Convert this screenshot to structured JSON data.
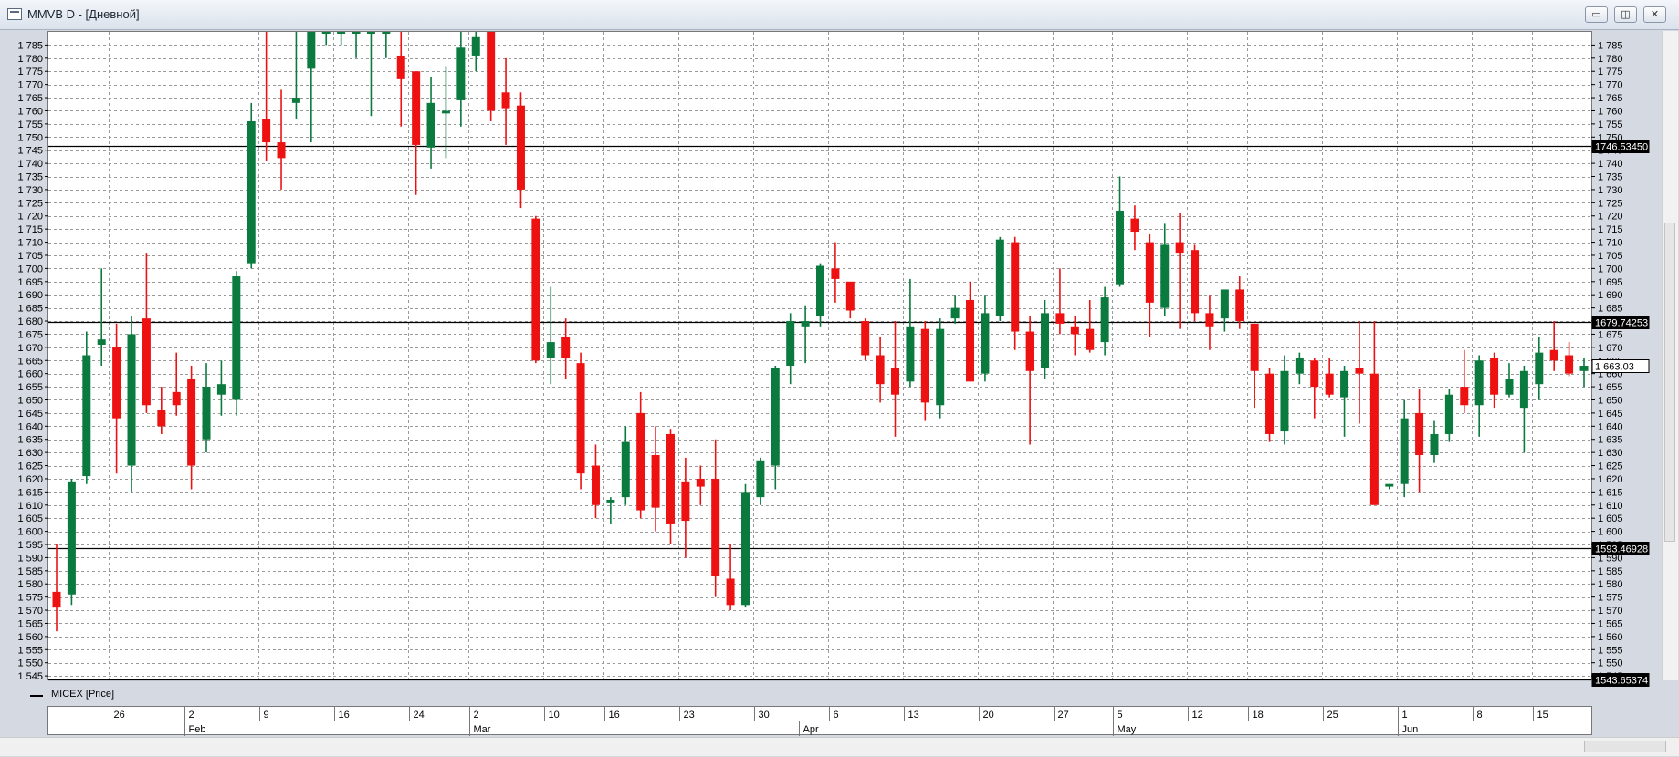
{
  "window": {
    "title": "MMVB D - [Дневной]",
    "buttons": {
      "minimize": "▭",
      "restore": "◫",
      "close": "✕"
    }
  },
  "legend": {
    "label": "MICEX [Price]"
  },
  "colors": {
    "up": "#0a7a3e",
    "down": "#ee1111",
    "grid": "#9a9a9a",
    "hline": "#000000",
    "marker_bg": "#000000",
    "marker_fg": "#ffffff"
  },
  "chart_data": {
    "type": "candlestick",
    "title": "",
    "ylim": [
      1543.65,
      1790
    ],
    "y_ticks": [
      1545,
      1550,
      1555,
      1560,
      1565,
      1570,
      1575,
      1580,
      1585,
      1590,
      1595,
      1600,
      1605,
      1610,
      1615,
      1620,
      1625,
      1630,
      1635,
      1640,
      1645,
      1650,
      1655,
      1660,
      1665,
      1670,
      1675,
      1680,
      1685,
      1690,
      1695,
      1700,
      1705,
      1710,
      1715,
      1720,
      1725,
      1730,
      1735,
      1740,
      1745,
      1750,
      1755,
      1760,
      1765,
      1770,
      1775,
      1780,
      1785
    ],
    "y_tick_labels": [
      "1 545",
      "1 550",
      "1 555",
      "1 560",
      "1 565",
      "1 570",
      "1 575",
      "1 580",
      "1 585",
      "1 590",
      "1 595",
      "1 600",
      "1 605",
      "1 610",
      "1 615",
      "1 620",
      "1 625",
      "1 630",
      "1 635",
      "1 640",
      "1 645",
      "1 650",
      "1 655",
      "1 660",
      "1 665",
      "1 670",
      "1 675",
      "1 680",
      "1 685",
      "1 690",
      "1 695",
      "1 700",
      "1 705",
      "1 710",
      "1 715",
      "1 720",
      "1 725",
      "1 730",
      "1 735",
      "1 740",
      "1 745",
      "1 750",
      "1 755",
      "1 760",
      "1 765",
      "1 770",
      "1 775",
      "1 780",
      "1 785"
    ],
    "horizontal_lines": [
      {
        "value": 1746.5345,
        "label": "1746.53450",
        "style": "black"
      },
      {
        "value": 1679.74253,
        "label": "1679.74253",
        "style": "black"
      },
      {
        "value": 1663.03,
        "label": "1 663.03",
        "style": "boxed"
      },
      {
        "value": 1593.46928,
        "label": "1593.46928",
        "style": "black"
      },
      {
        "value": 1543.65374,
        "label": "1543.65374",
        "style": "black"
      }
    ],
    "day_labels": [
      {
        "index": 4,
        "text": "26"
      },
      {
        "index": 9,
        "text": "2"
      },
      {
        "index": 14,
        "text": "9"
      },
      {
        "index": 19,
        "text": "16"
      },
      {
        "index": 24,
        "text": "24"
      },
      {
        "index": 28,
        "text": "2"
      },
      {
        "index": 33,
        "text": "10"
      },
      {
        "index": 37,
        "text": "16"
      },
      {
        "index": 42,
        "text": "23"
      },
      {
        "index": 47,
        "text": "30"
      },
      {
        "index": 52,
        "text": "6"
      },
      {
        "index": 57,
        "text": "13"
      },
      {
        "index": 62,
        "text": "20"
      },
      {
        "index": 67,
        "text": "27"
      },
      {
        "index": 71,
        "text": "5"
      },
      {
        "index": 76,
        "text": "12"
      },
      {
        "index": 80,
        "text": "18"
      },
      {
        "index": 85,
        "text": "25"
      },
      {
        "index": 90,
        "text": "1"
      },
      {
        "index": 95,
        "text": "8"
      },
      {
        "index": 99,
        "text": "15"
      }
    ],
    "month_labels": [
      {
        "index": 9,
        "text": "Feb"
      },
      {
        "index": 28,
        "text": "Mar"
      },
      {
        "index": 50,
        "text": "Apr"
      },
      {
        "index": 71,
        "text": "May"
      },
      {
        "index": 90,
        "text": "Jun"
      }
    ],
    "candles": [
      [
        1577,
        1595,
        1562,
        1571
      ],
      [
        1576,
        1620,
        1572,
        1619
      ],
      [
        1621,
        1676,
        1618,
        1667
      ],
      [
        1671,
        1700,
        1663,
        1673
      ],
      [
        1670,
        1679,
        1622,
        1643
      ],
      [
        1625,
        1682,
        1615,
        1675
      ],
      [
        1681,
        1706,
        1645,
        1648
      ],
      [
        1646,
        1655,
        1637,
        1640
      ],
      [
        1653,
        1668,
        1644,
        1648
      ],
      [
        1658,
        1663,
        1616,
        1625
      ],
      [
        1635,
        1664,
        1630,
        1655
      ],
      [
        1652,
        1665,
        1644,
        1656
      ],
      [
        1650,
        1699,
        1644,
        1697
      ],
      [
        1702,
        1763,
        1700,
        1756
      ],
      [
        1757,
        1790,
        1741,
        1748
      ],
      [
        1748,
        1768,
        1730,
        1742
      ],
      [
        1763,
        1790,
        1757,
        1765
      ],
      [
        1776,
        1790,
        1748,
        1790
      ],
      [
        1790,
        1790,
        1785,
        1790
      ],
      [
        1790,
        1790,
        1785,
        1790
      ],
      [
        1790,
        1790,
        1780,
        1790
      ],
      [
        1790,
        1790,
        1758,
        1790
      ],
      [
        1790,
        1790,
        1780,
        1790
      ],
      [
        1781,
        1790,
        1754,
        1772
      ],
      [
        1775,
        1774,
        1728,
        1747
      ],
      [
        1746,
        1773,
        1738,
        1763
      ],
      [
        1759,
        1777,
        1742,
        1760
      ],
      [
        1764,
        1790,
        1754,
        1784
      ],
      [
        1781,
        1790,
        1775,
        1788
      ],
      [
        1790,
        1790,
        1756,
        1760
      ],
      [
        1767,
        1780,
        1747,
        1761
      ],
      [
        1762,
        1767,
        1723,
        1730
      ],
      [
        1719,
        1720,
        1664,
        1665
      ],
      [
        1666,
        1693,
        1656,
        1672
      ],
      [
        1674,
        1681,
        1658,
        1666
      ],
      [
        1664,
        1668,
        1616,
        1622
      ],
      [
        1625,
        1633,
        1605,
        1610
      ],
      [
        1611,
        1613,
        1603,
        1612
      ],
      [
        1613,
        1640,
        1610,
        1634
      ],
      [
        1645,
        1653,
        1605,
        1608
      ],
      [
        1629,
        1640,
        1600,
        1609
      ],
      [
        1637,
        1639,
        1595,
        1603
      ],
      [
        1619,
        1628,
        1590,
        1604
      ],
      [
        1620,
        1625,
        1610,
        1617
      ],
      [
        1620,
        1635,
        1575,
        1583
      ],
      [
        1582,
        1595,
        1570,
        1572
      ],
      [
        1572,
        1618,
        1571,
        1615
      ],
      [
        1613,
        1628,
        1610,
        1627
      ],
      [
        1625,
        1663,
        1616,
        1662
      ],
      [
        1663,
        1683,
        1656,
        1680
      ],
      [
        1678,
        1686,
        1664,
        1680
      ],
      [
        1682,
        1702,
        1678,
        1701
      ],
      [
        1700,
        1710,
        1687,
        1696
      ],
      [
        1695,
        1694,
        1681,
        1684
      ],
      [
        1680,
        1681,
        1665,
        1667
      ],
      [
        1667,
        1674,
        1649,
        1656
      ],
      [
        1662,
        1680,
        1636,
        1652
      ],
      [
        1657,
        1696,
        1655,
        1678
      ],
      [
        1677,
        1680,
        1642,
        1649
      ],
      [
        1648,
        1681,
        1643,
        1677
      ],
      [
        1681,
        1690,
        1679,
        1685
      ],
      [
        1688,
        1695,
        1657,
        1657
      ],
      [
        1660,
        1690,
        1657,
        1683
      ],
      [
        1682,
        1712,
        1680,
        1711
      ],
      [
        1710,
        1712,
        1669,
        1676
      ],
      [
        1676,
        1682,
        1633,
        1661
      ],
      [
        1662,
        1688,
        1658,
        1683
      ],
      [
        1683,
        1700,
        1675,
        1679
      ],
      [
        1678,
        1682,
        1667,
        1675
      ],
      [
        1677,
        1688,
        1668,
        1669
      ],
      [
        1672,
        1693,
        1667,
        1689
      ],
      [
        1694,
        1735,
        1693,
        1722
      ],
      [
        1719,
        1724,
        1707,
        1714
      ],
      [
        1710,
        1713,
        1674,
        1687
      ],
      [
        1685,
        1717,
        1682,
        1709
      ],
      [
        1710,
        1721,
        1677,
        1706
      ],
      [
        1707,
        1709,
        1680,
        1683
      ],
      [
        1683,
        1690,
        1669,
        1678
      ],
      [
        1681,
        1692,
        1676,
        1692
      ],
      [
        1692,
        1697,
        1677,
        1680
      ],
      [
        1679,
        1679,
        1647,
        1661
      ],
      [
        1660,
        1662,
        1634,
        1637
      ],
      [
        1638,
        1667,
        1633,
        1661
      ],
      [
        1660,
        1668,
        1656,
        1666
      ],
      [
        1665,
        1666,
        1643,
        1655
      ],
      [
        1660,
        1666,
        1651,
        1652
      ],
      [
        1651,
        1663,
        1636,
        1661
      ],
      [
        1662,
        1680,
        1641,
        1660
      ],
      [
        1660,
        1680,
        1610,
        1610
      ],
      [
        1617,
        1618,
        1616,
        1618
      ],
      [
        1618,
        1650,
        1613,
        1643
      ],
      [
        1645,
        1654,
        1615,
        1629
      ],
      [
        1629,
        1642,
        1626,
        1637
      ],
      [
        1637,
        1654,
        1634,
        1652
      ],
      [
        1655,
        1669,
        1645,
        1648
      ],
      [
        1648,
        1667,
        1636,
        1665
      ],
      [
        1666,
        1668,
        1647,
        1652
      ],
      [
        1652,
        1664,
        1651,
        1658
      ],
      [
        1647,
        1663,
        1630,
        1661
      ],
      [
        1656,
        1674,
        1650,
        1668
      ],
      [
        1669,
        1680,
        1661,
        1665
      ],
      [
        1667,
        1672,
        1659,
        1660
      ],
      [
        1661,
        1666,
        1655,
        1663
      ]
    ]
  }
}
